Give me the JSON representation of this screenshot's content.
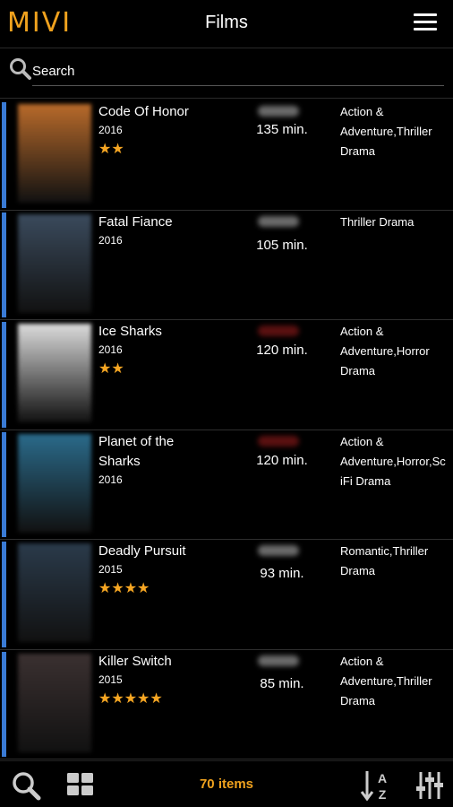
{
  "header": {
    "logo": "MIVI",
    "title": "Films",
    "menu_icon": "hamburger-menu-icon"
  },
  "search": {
    "placeholder": "Search"
  },
  "films": [
    {
      "title": "Code Of Honor",
      "year": "2016",
      "stars": "★★",
      "duration": "135 min.",
      "genres": "Action & Adventure,Thriller Drama",
      "poster_color": "#b86a2a"
    },
    {
      "title": "Fatal Fiance",
      "year": "2016",
      "stars": "",
      "duration": "105 min.",
      "genres": "Thriller Drama",
      "poster_color": "#3a4a5c"
    },
    {
      "title": "Ice Sharks",
      "year": "2016",
      "stars": "★★",
      "duration": "120 min.",
      "genres": "Action & Adventure,Horror Drama",
      "poster_color": "#dcdcdc"
    },
    {
      "title": "Planet of the Sharks",
      "year": "2016",
      "stars": "",
      "duration": "120 min.",
      "genres": "Action & Adventure,Horror,Sc iFi Drama",
      "poster_color": "#2a6a8a"
    },
    {
      "title": "Deadly Pursuit",
      "year": "2015",
      "stars": "★★★★",
      "duration": "93 min.",
      "genres": "Romantic,Thriller Drama",
      "poster_color": "#2a3a4a"
    },
    {
      "title": "Killer Switch",
      "year": "2015",
      "stars": "★★★★★",
      "duration": "85 min.",
      "genres": "Action & Adventure,Thriller Drama",
      "poster_color": "#3a3030"
    }
  ],
  "footer": {
    "items_count": "70 items"
  },
  "colors": {
    "accent": "#3a7bd5",
    "brand": "#f0a21e",
    "star": "#f6a623"
  }
}
